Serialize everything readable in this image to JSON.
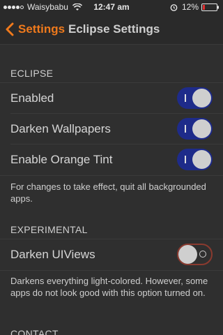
{
  "status_bar": {
    "carrier": "Waisybabu",
    "time": "12:47 am",
    "battery": "12%"
  },
  "nav": {
    "back_label": "Settings",
    "title": "Eclipse Settings"
  },
  "sections": {
    "eclipse": {
      "header": "ECLIPSE",
      "rows": [
        {
          "label": "Enabled",
          "on": true
        },
        {
          "label": "Darken Wallpapers",
          "on": true
        },
        {
          "label": "Enable Orange Tint",
          "on": true
        }
      ],
      "footer": "For changes to take effect, quit all backgrounded apps."
    },
    "experimental": {
      "header": "EXPERIMENTAL",
      "rows": [
        {
          "label": "Darken UIViews",
          "on": false
        }
      ],
      "footer": "Darkens everything light-colored. However, some apps do not look good with this option turned on."
    },
    "contact": {
      "header": "CONTACT"
    }
  },
  "colors": {
    "accent": "#f07a1c",
    "toggle_on": "#1e2b8a",
    "toggle_off_border": "#8a3a2f",
    "background": "#2f2f2f"
  }
}
